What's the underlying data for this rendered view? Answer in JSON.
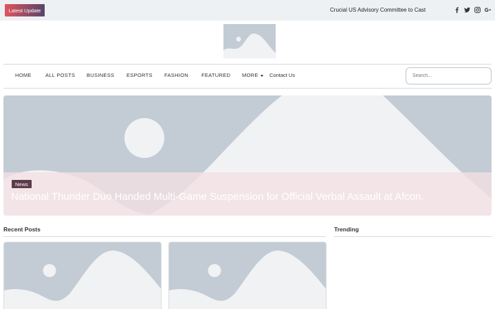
{
  "topbar": {
    "latest_label": "Latest Update",
    "ticker_text": "Crucial US Advisory Committee to Cast",
    "social_icons": [
      "facebook-icon",
      "twitter-icon",
      "instagram-icon",
      "google-plus-icon"
    ],
    "colors": {
      "background": "#eef1f4",
      "button_gradient_start": "#e0555d",
      "button_gradient_end": "#56456b"
    }
  },
  "nav": {
    "items": [
      {
        "label": "HOME"
      },
      {
        "label": "ALL POSTS"
      },
      {
        "label": "BUSINESS"
      },
      {
        "label": "ESPORTS"
      },
      {
        "label": "FASHION"
      },
      {
        "label": "FEATURED"
      },
      {
        "label": "MORE"
      },
      {
        "label": "Contact Us"
      }
    ],
    "search_placeholder": "Search..."
  },
  "hero": {
    "category": "News",
    "title": "National Thunder Duo Handed Multi-Game Suspension for Official Verbal Assault at Afcon.",
    "colors": {
      "placeholder_bg": "#c3ccd5",
      "placeholder_fg": "#f1f2f4",
      "badge": "#5d3c49"
    }
  },
  "sections": {
    "recent_posts": "Recent Posts",
    "trending": "Trending"
  }
}
